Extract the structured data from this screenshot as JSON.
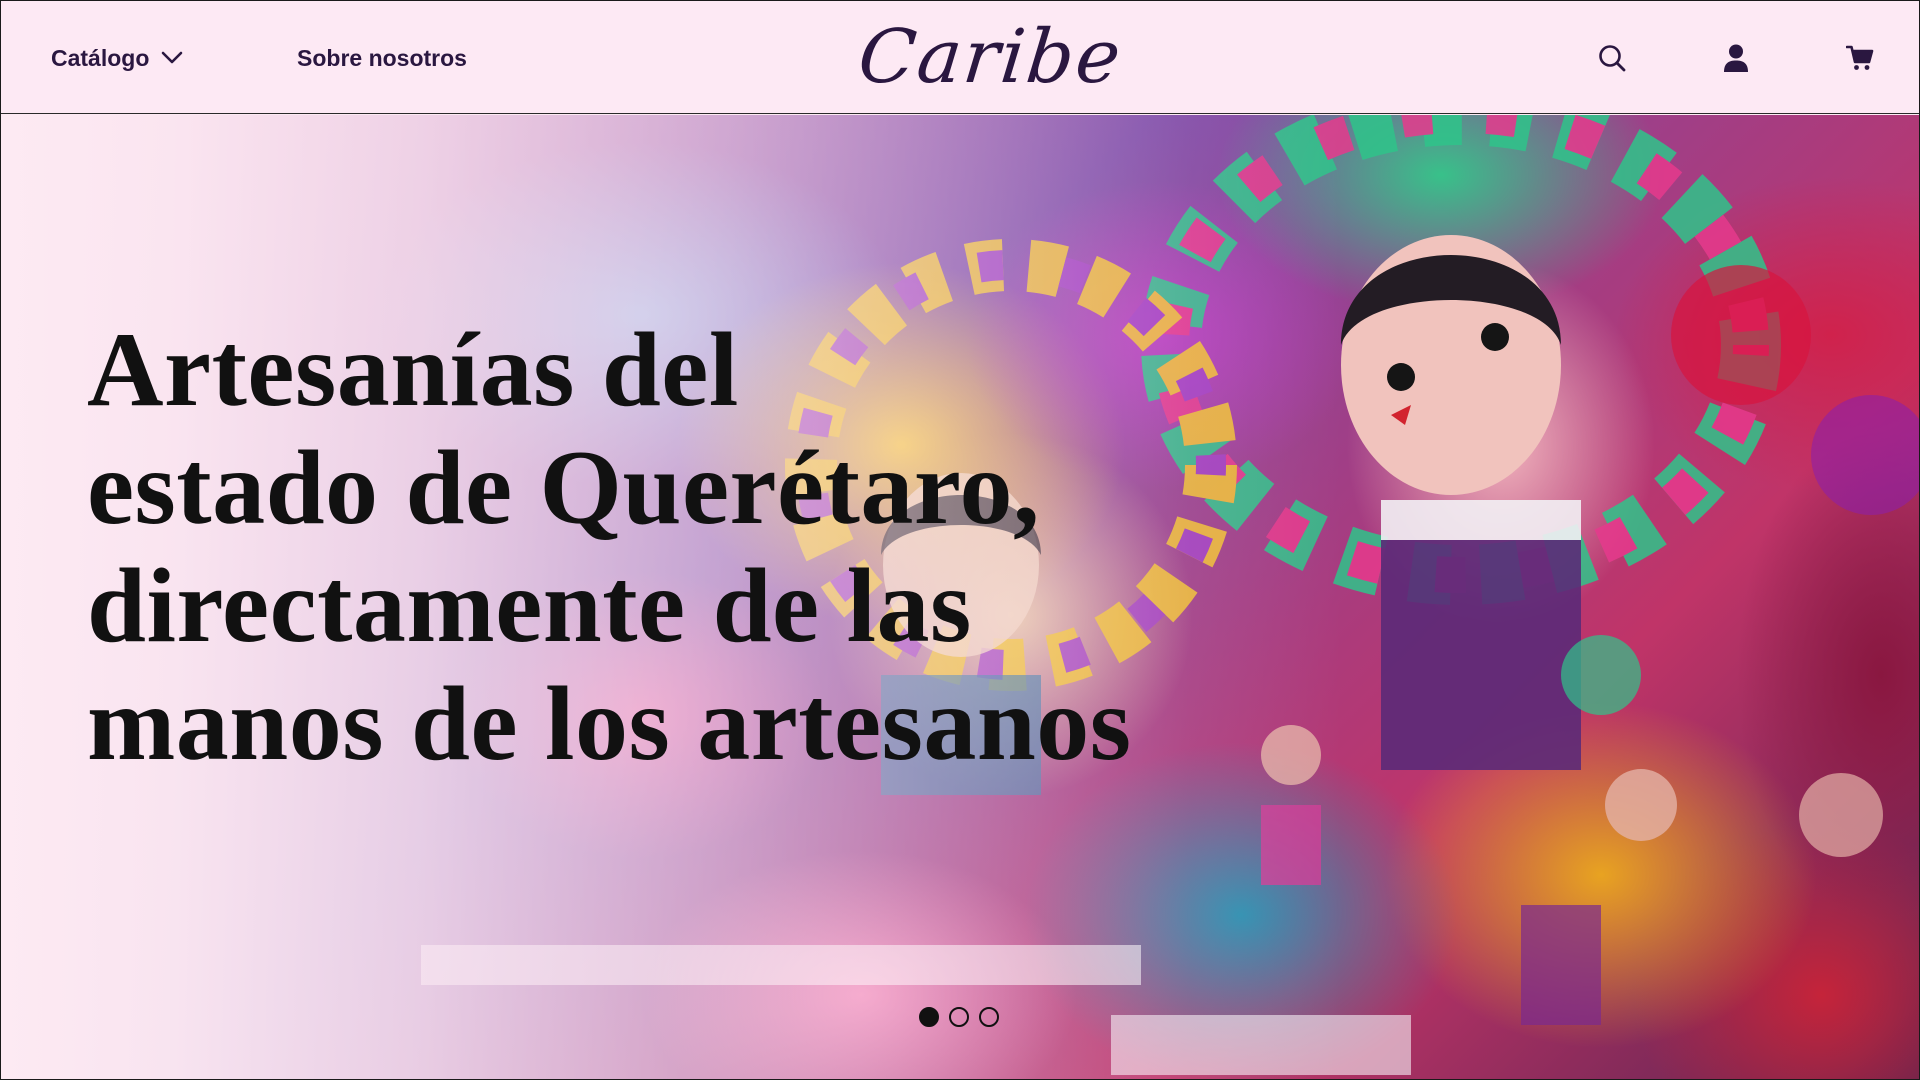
{
  "header": {
    "nav": {
      "catalogo_label": "Catálogo",
      "about_label": "Sobre nosotros"
    },
    "logo_text": "Caribe",
    "icons": [
      "chevron-down-icon",
      "search-icon",
      "user-icon",
      "cart-icon"
    ]
  },
  "hero": {
    "title_lines": [
      "Artesanías del",
      "estado de Querétaro,",
      "directamente de las",
      "manos de los artesanos"
    ],
    "carousel": {
      "slide_count": 3,
      "active_index": 0
    }
  },
  "colors": {
    "header_bg": "#fde9f4",
    "brand_text": "#2a1740",
    "hero_text": "#111111"
  }
}
